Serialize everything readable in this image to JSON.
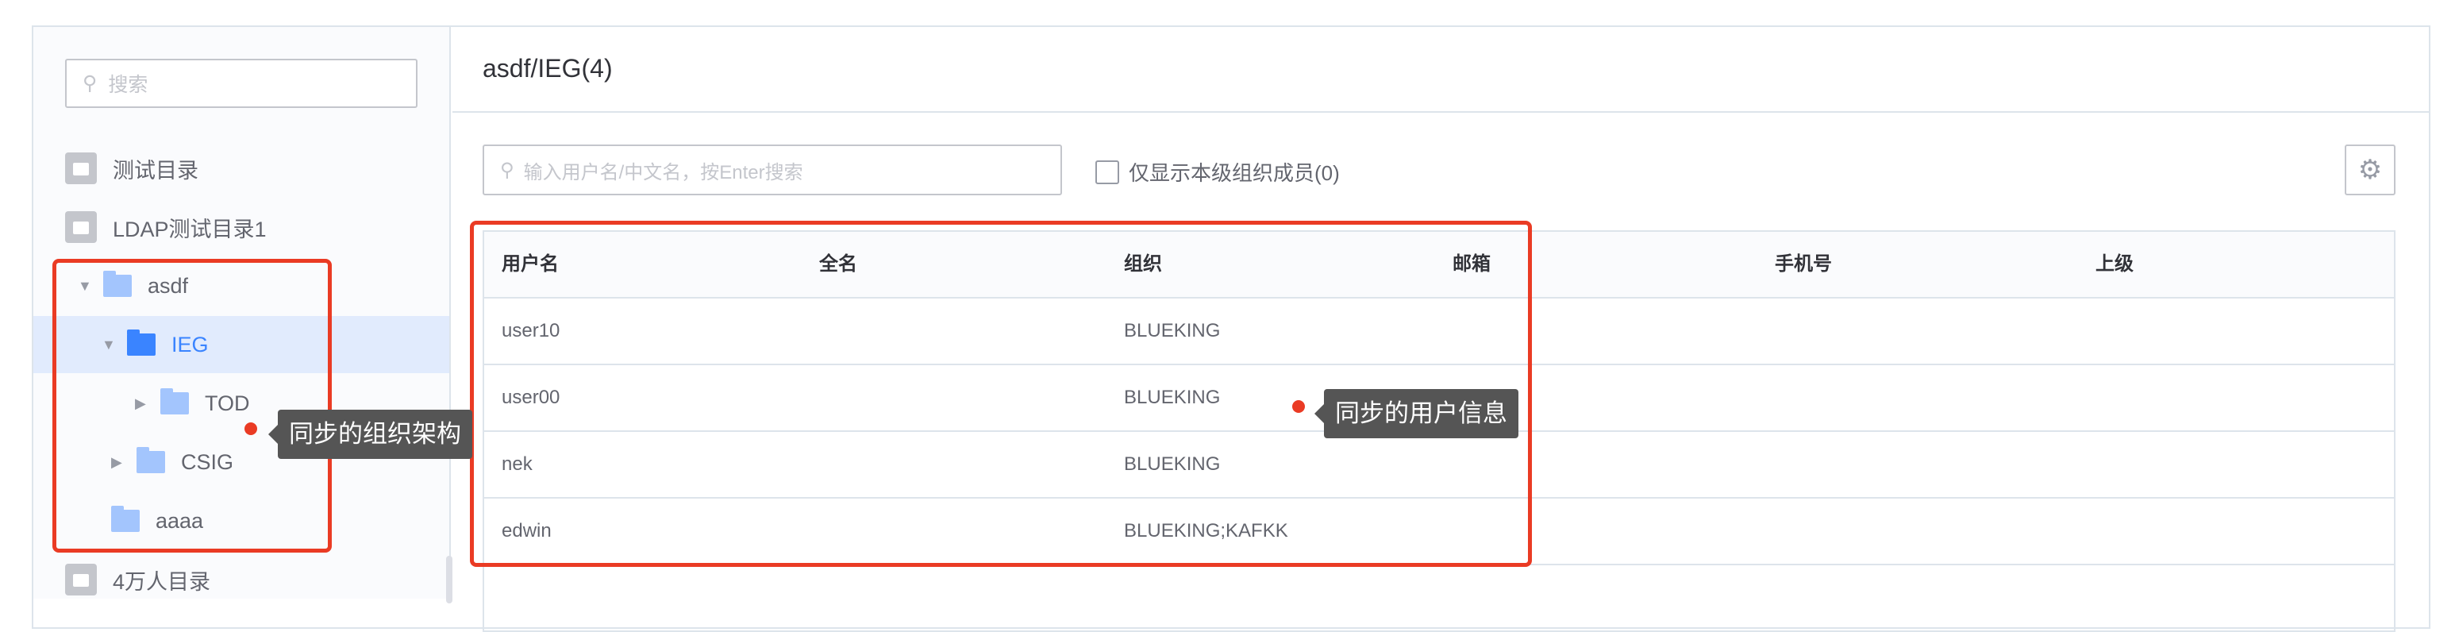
{
  "sidebar": {
    "search_placeholder": "搜索",
    "items": [
      {
        "label": "测试目录",
        "type": "directory"
      },
      {
        "label": "LDAP测试目录1",
        "type": "directory"
      },
      {
        "label": "asdf",
        "type": "folder",
        "expanded": true
      },
      {
        "label": "IEG",
        "type": "folder",
        "expanded": true,
        "selected": true
      },
      {
        "label": "TOD",
        "type": "folder",
        "expanded": false
      },
      {
        "label": "CSIG",
        "type": "folder",
        "expanded": false
      },
      {
        "label": "aaaa",
        "type": "folder"
      },
      {
        "label": "4万人目录",
        "type": "directory"
      }
    ]
  },
  "main": {
    "title": "asdf/IEG(4)",
    "search_placeholder": "输入用户名/中文名，按Enter搜索",
    "checkbox_label": "仅显示本级组织成员(0)",
    "columns": [
      "用户名",
      "全名",
      "组织",
      "邮箱",
      "手机号",
      "上级"
    ],
    "rows": [
      [
        "user10",
        "",
        "BLUEKING",
        "",
        "",
        ""
      ],
      [
        "user00",
        "",
        "BLUEKING",
        "",
        "",
        ""
      ],
      [
        "nek",
        "",
        "BLUEKING",
        "",
        "",
        ""
      ],
      [
        "edwin",
        "",
        "BLUEKING;KAFKK",
        "",
        "",
        ""
      ]
    ]
  },
  "annotations": {
    "org": "同步的组织架构",
    "user": "同步的用户信息",
    "color": "#ea3b24"
  }
}
